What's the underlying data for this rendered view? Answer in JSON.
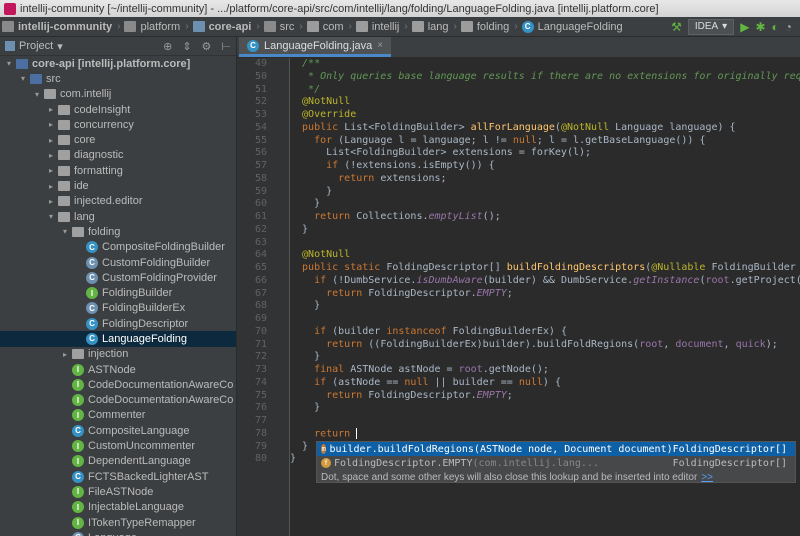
{
  "window": {
    "title": "intellij-community [~/intellij-community] - .../platform/core-api/src/com/intellij/lang/folding/LanguageFolding.java [intellij.platform.core]"
  },
  "breadcrumbs": [
    {
      "label": "intellij-community",
      "icon": "folder-icon"
    },
    {
      "label": "platform",
      "icon": "folder-icon"
    },
    {
      "label": "core-api",
      "icon": "module-icon"
    },
    {
      "label": "src",
      "icon": "folder-icon"
    },
    {
      "label": "com",
      "icon": "package-icon"
    },
    {
      "label": "intellij",
      "icon": "package-icon"
    },
    {
      "label": "lang",
      "icon": "package-icon"
    },
    {
      "label": "folding",
      "icon": "package-icon"
    },
    {
      "label": "LanguageFolding",
      "icon": "class-icon"
    }
  ],
  "toolbar": {
    "run_config": "IDEA"
  },
  "sidebar": {
    "title": "Project",
    "tree": [
      {
        "label": "core-api [intellij.platform.core]",
        "depth": 0,
        "arrow": "▾",
        "icon": "module",
        "bold": true
      },
      {
        "label": "src",
        "depth": 1,
        "arrow": "▾",
        "icon": "src"
      },
      {
        "label": "com.intellij",
        "depth": 2,
        "arrow": "▾",
        "icon": "pkg"
      },
      {
        "label": "codeInsight",
        "depth": 3,
        "arrow": "▸",
        "icon": "pkg"
      },
      {
        "label": "concurrency",
        "depth": 3,
        "arrow": "▸",
        "icon": "pkg"
      },
      {
        "label": "core",
        "depth": 3,
        "arrow": "▸",
        "icon": "pkg"
      },
      {
        "label": "diagnostic",
        "depth": 3,
        "arrow": "▸",
        "icon": "pkg"
      },
      {
        "label": "formatting",
        "depth": 3,
        "arrow": "▸",
        "icon": "pkg"
      },
      {
        "label": "ide",
        "depth": 3,
        "arrow": "▸",
        "icon": "pkg"
      },
      {
        "label": "injected.editor",
        "depth": 3,
        "arrow": "▸",
        "icon": "pkg"
      },
      {
        "label": "lang",
        "depth": 3,
        "arrow": "▾",
        "icon": "pkg"
      },
      {
        "label": "folding",
        "depth": 4,
        "arrow": "▾",
        "icon": "pkg"
      },
      {
        "label": "CompositeFoldingBuilder",
        "depth": 5,
        "arrow": "",
        "icon": "c"
      },
      {
        "label": "CustomFoldingBuilder",
        "depth": 5,
        "arrow": "",
        "icon": "ab"
      },
      {
        "label": "CustomFoldingProvider",
        "depth": 5,
        "arrow": "",
        "icon": "ab"
      },
      {
        "label": "FoldingBuilder",
        "depth": 5,
        "arrow": "",
        "icon": "i"
      },
      {
        "label": "FoldingBuilderEx",
        "depth": 5,
        "arrow": "",
        "icon": "ab"
      },
      {
        "label": "FoldingDescriptor",
        "depth": 5,
        "arrow": "",
        "icon": "c"
      },
      {
        "label": "LanguageFolding",
        "depth": 5,
        "arrow": "",
        "icon": "c",
        "selected": true
      },
      {
        "label": "injection",
        "depth": 4,
        "arrow": "▸",
        "icon": "pkg"
      },
      {
        "label": "ASTNode",
        "depth": 4,
        "arrow": "",
        "icon": "i"
      },
      {
        "label": "CodeDocumentationAwareCo",
        "depth": 4,
        "arrow": "",
        "icon": "i"
      },
      {
        "label": "CodeDocumentationAwareCo",
        "depth": 4,
        "arrow": "",
        "icon": "i"
      },
      {
        "label": "Commenter",
        "depth": 4,
        "arrow": "",
        "icon": "i"
      },
      {
        "label": "CompositeLanguage",
        "depth": 4,
        "arrow": "",
        "icon": "c"
      },
      {
        "label": "CustomUncommenter",
        "depth": 4,
        "arrow": "",
        "icon": "i"
      },
      {
        "label": "DependentLanguage",
        "depth": 4,
        "arrow": "",
        "icon": "i"
      },
      {
        "label": "FCTSBackedLighterAST",
        "depth": 4,
        "arrow": "",
        "icon": "c"
      },
      {
        "label": "FileASTNode",
        "depth": 4,
        "arrow": "",
        "icon": "i"
      },
      {
        "label": "InjectableLanguage",
        "depth": 4,
        "arrow": "",
        "icon": "i"
      },
      {
        "label": "ITokenTypeRemapper",
        "depth": 4,
        "arrow": "",
        "icon": "i"
      },
      {
        "label": "Language",
        "depth": 4,
        "arrow": "",
        "icon": "ab"
      }
    ]
  },
  "editor": {
    "tab_label": "LanguageFolding.java",
    "line_numbers": [
      "49",
      "50",
      "51",
      "52",
      "53",
      "54",
      "55",
      "56",
      "57",
      "58",
      "59",
      "60",
      "61",
      "62",
      "63",
      "64",
      "65",
      "66",
      "67",
      "68",
      "69",
      "70",
      "71",
      "72",
      "73",
      "74",
      "75",
      "76",
      "77",
      "78",
      "79",
      "80"
    ],
    "lines": [
      [
        {
          "t": "  /**",
          "c": "cm"
        }
      ],
      [
        {
          "t": "   * Only queries base language results if there are no extensions for originally requested",
          "c": "cm"
        }
      ],
      [
        {
          "t": "   */",
          "c": "cm"
        }
      ],
      [
        {
          "t": "  @NotNull",
          "c": "an"
        }
      ],
      [
        {
          "t": "  @Override",
          "c": "an"
        }
      ],
      [
        {
          "t": "  public ",
          "c": "kw"
        },
        {
          "t": "List<FoldingBuilder> ",
          "c": "pm"
        },
        {
          "t": "allForLanguage",
          "c": "fn"
        },
        {
          "t": "(",
          "c": "pm"
        },
        {
          "t": "@NotNull ",
          "c": "an"
        },
        {
          "t": "Language ",
          "c": "pm"
        },
        {
          "t": "language",
          "c": "pm"
        },
        {
          "t": ") {",
          "c": "pm"
        }
      ],
      [
        {
          "t": "    for ",
          "c": "kw"
        },
        {
          "t": "(Language ",
          "c": "pm"
        },
        {
          "t": "l",
          "c": "pm"
        },
        {
          "t": " = language; ",
          "c": "pm"
        },
        {
          "t": "l",
          "c": "pm"
        },
        {
          "t": " != ",
          "c": "pm"
        },
        {
          "t": "null",
          "c": "kw"
        },
        {
          "t": "; l = l.getBaseLanguage()) {",
          "c": "pm"
        }
      ],
      [
        {
          "t": "      List<FoldingBuilder> extensions = forKey(l);",
          "c": "pm"
        }
      ],
      [
        {
          "t": "      if ",
          "c": "kw"
        },
        {
          "t": "(!extensions.isEmpty()) {",
          "c": "pm"
        }
      ],
      [
        {
          "t": "        return ",
          "c": "kw"
        },
        {
          "t": "extensions;",
          "c": "pm"
        }
      ],
      [
        {
          "t": "      }",
          "c": "pm"
        }
      ],
      [
        {
          "t": "    }",
          "c": "pm"
        }
      ],
      [
        {
          "t": "    return ",
          "c": "kw"
        },
        {
          "t": "Collections.",
          "c": "pm"
        },
        {
          "t": "emptyList",
          "c": "it"
        },
        {
          "t": "();",
          "c": "pm"
        }
      ],
      [
        {
          "t": "  }",
          "c": "pm"
        }
      ],
      [
        {
          "t": "",
          "c": "pm"
        }
      ],
      [
        {
          "t": "  @NotNull",
          "c": "an"
        }
      ],
      [
        {
          "t": "  public static ",
          "c": "kw"
        },
        {
          "t": "FoldingDescriptor[] ",
          "c": "pm"
        },
        {
          "t": "buildFoldingDescriptors",
          "c": "fn"
        },
        {
          "t": "(",
          "c": "pm"
        },
        {
          "t": "@Nullable ",
          "c": "an"
        },
        {
          "t": "FoldingBuilder builder",
          "c": "pm"
        }
      ],
      [
        {
          "t": "    if ",
          "c": "kw"
        },
        {
          "t": "(!DumbService.",
          "c": "pm"
        },
        {
          "t": "isDumbAware",
          "c": "it"
        },
        {
          "t": "(builder) && DumbService.",
          "c": "pm"
        },
        {
          "t": "getInstance",
          "c": "it"
        },
        {
          "t": "(",
          "c": "pm"
        },
        {
          "t": "root",
          "c": "pv"
        },
        {
          "t": ".getProject()).isDu",
          "c": "pm"
        }
      ],
      [
        {
          "t": "      return ",
          "c": "kw"
        },
        {
          "t": "FoldingDescriptor.",
          "c": "pm"
        },
        {
          "t": "EMPTY",
          "c": "it"
        },
        {
          "t": ";",
          "c": "pm"
        }
      ],
      [
        {
          "t": "    }",
          "c": "pm"
        }
      ],
      [
        {
          "t": "",
          "c": "pm"
        }
      ],
      [
        {
          "t": "    if ",
          "c": "kw"
        },
        {
          "t": "(builder ",
          "c": "pm"
        },
        {
          "t": "instanceof ",
          "c": "kw"
        },
        {
          "t": "FoldingBuilderEx) {",
          "c": "pm"
        }
      ],
      [
        {
          "t": "      return ",
          "c": "kw"
        },
        {
          "t": "((FoldingBuilderEx)builder).buildFoldRegions(",
          "c": "pm"
        },
        {
          "t": "root",
          "c": "pv"
        },
        {
          "t": ", ",
          "c": "pm"
        },
        {
          "t": "document",
          "c": "pv"
        },
        {
          "t": ", ",
          "c": "pm"
        },
        {
          "t": "quick",
          "c": "pv"
        },
        {
          "t": ");",
          "c": "pm"
        }
      ],
      [
        {
          "t": "    }",
          "c": "pm"
        }
      ],
      [
        {
          "t": "    final ",
          "c": "kw"
        },
        {
          "t": "ASTNode astNode = ",
          "c": "pm"
        },
        {
          "t": "root",
          "c": "pv"
        },
        {
          "t": ".getNode();",
          "c": "pm"
        }
      ],
      [
        {
          "t": "    if ",
          "c": "kw"
        },
        {
          "t": "(astNode == ",
          "c": "pm"
        },
        {
          "t": "null ",
          "c": "kw"
        },
        {
          "t": "|| builder == ",
          "c": "pm"
        },
        {
          "t": "null",
          "c": "kw"
        },
        {
          "t": ") {",
          "c": "pm"
        }
      ],
      [
        {
          "t": "      return ",
          "c": "kw"
        },
        {
          "t": "FoldingDescriptor.",
          "c": "pm"
        },
        {
          "t": "EMPTY",
          "c": "it"
        },
        {
          "t": ";",
          "c": "pm"
        }
      ],
      [
        {
          "t": "    }",
          "c": "pm"
        }
      ],
      [
        {
          "t": "",
          "c": "pm"
        }
      ],
      [
        {
          "t": "    return ",
          "c": "kw"
        },
        {
          "t": "",
          "c": "caret"
        }
      ],
      [
        {
          "t": "  }",
          "c": "pm"
        }
      ],
      [
        {
          "t": "}",
          "c": "pm"
        }
      ]
    ]
  },
  "completion": {
    "items": [
      {
        "icon": "m",
        "text": "builder.buildFoldRegions(ASTNode node, Document document)",
        "grey": "",
        "type": "FoldingDescriptor[]",
        "selected": true
      },
      {
        "icon": "f",
        "text": "FoldingDescriptor.EMPTY ",
        "grey": "(com.intellij.lang...",
        "type": "FoldingDescriptor[]",
        "selected": false
      }
    ],
    "hint": "Dot, space and some other keys will also close this lookup and be inserted into editor",
    "hint_more": ">>"
  }
}
